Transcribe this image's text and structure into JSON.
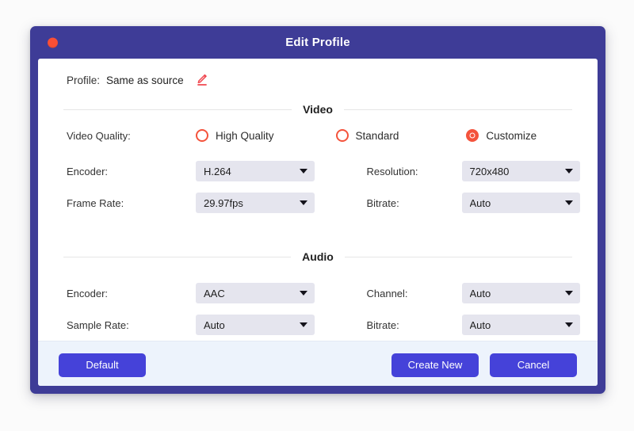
{
  "window": {
    "title": "Edit Profile",
    "close_icon": "close-circle-icon",
    "accent_purple": "#3e3c97",
    "accent_button": "#4542d9",
    "accent_radio": "#f4533c",
    "footer_bg": "#edf3fc",
    "dropdown_bg": "#e5e5ee"
  },
  "profile": {
    "label": "Profile:",
    "value": "Same as source",
    "edit_icon": "pencil-edit-icon"
  },
  "video": {
    "section_title": "Video",
    "quality_label": "Video Quality:",
    "quality_options": [
      {
        "label": "High Quality",
        "selected": false
      },
      {
        "label": "Standard",
        "selected": false
      },
      {
        "label": "Customize",
        "selected": true
      }
    ],
    "encoder_label": "Encoder:",
    "encoder_value": "H.264",
    "resolution_label": "Resolution:",
    "resolution_value": "720x480",
    "frame_rate_label": "Frame Rate:",
    "frame_rate_value": "29.97fps",
    "bitrate_label": "Bitrate:",
    "bitrate_value": "Auto"
  },
  "audio": {
    "section_title": "Audio",
    "encoder_label": "Encoder:",
    "encoder_value": "AAC",
    "channel_label": "Channel:",
    "channel_value": "Auto",
    "sample_rate_label": "Sample Rate:",
    "sample_rate_value": "Auto",
    "bitrate_label": "Bitrate:",
    "bitrate_value": "Auto"
  },
  "footer": {
    "default_label": "Default",
    "create_new_label": "Create New",
    "cancel_label": "Cancel"
  }
}
